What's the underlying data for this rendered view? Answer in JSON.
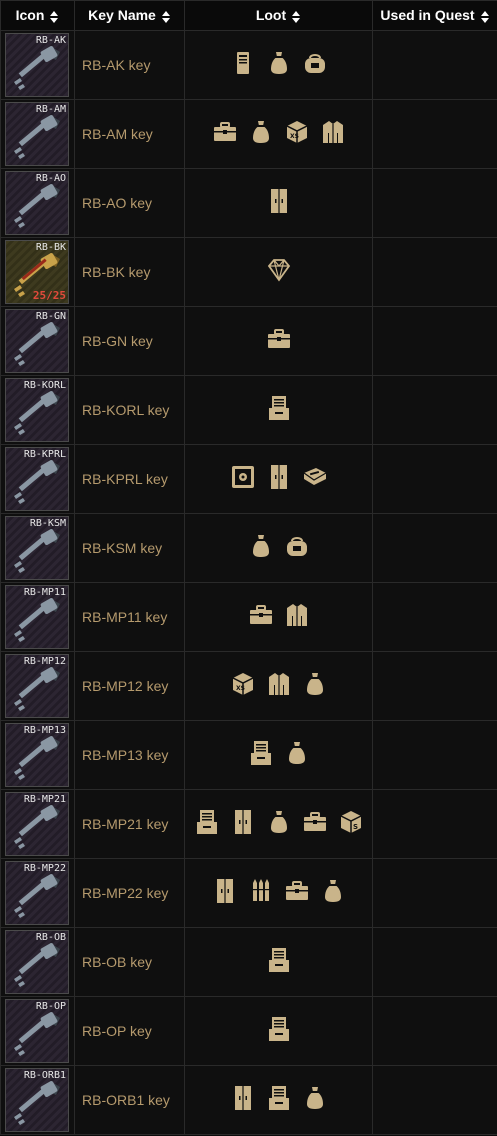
{
  "headers": {
    "icon": "Icon",
    "name": "Key Name",
    "loot": "Loot",
    "quest": "Used in Quest"
  },
  "rows": [
    {
      "code": "RB-AK",
      "name": "RB-AK key",
      "loot": [
        "pc-tower-icon",
        "sack-icon",
        "duffle-bag-icon"
      ],
      "uses": ""
    },
    {
      "code": "RB-AM",
      "name": "RB-AM key",
      "loot": [
        "toolbox-icon",
        "sack-icon",
        "xs-crate-icon",
        "jacket-icon"
      ],
      "uses": ""
    },
    {
      "code": "RB-AO",
      "name": "RB-AO key",
      "loot": [
        "locker-icon"
      ],
      "uses": ""
    },
    {
      "code": "RB-BK",
      "name": "RB-BK key",
      "loot": [
        "diamond-icon"
      ],
      "uses": "25/25"
    },
    {
      "code": "RB-GN",
      "name": "RB-GN key",
      "loot": [
        "toolbox-icon"
      ],
      "uses": ""
    },
    {
      "code": "RB-KORL",
      "name": "RB-KORL key",
      "loot": [
        "file-cabinet-icon"
      ],
      "uses": ""
    },
    {
      "code": "RB-KPRL",
      "name": "RB-KPRL key",
      "loot": [
        "safe-icon",
        "locker-icon",
        "weapon-box-icon"
      ],
      "uses": ""
    },
    {
      "code": "RB-KSM",
      "name": "RB-KSM key",
      "loot": [
        "sack-icon",
        "duffle-bag-icon"
      ],
      "uses": ""
    },
    {
      "code": "RB-MP11",
      "name": "RB-MP11 key",
      "loot": [
        "toolbox-icon",
        "jacket-icon"
      ],
      "uses": ""
    },
    {
      "code": "RB-MP12",
      "name": "RB-MP12 key",
      "loot": [
        "xs-crate-icon",
        "jacket-icon",
        "sack-icon"
      ],
      "uses": ""
    },
    {
      "code": "RB-MP13",
      "name": "RB-MP13 key",
      "loot": [
        "file-cabinet-icon",
        "sack-icon"
      ],
      "uses": ""
    },
    {
      "code": "RB-MP21",
      "name": "RB-MP21 key",
      "loot": [
        "file-cabinet-icon",
        "locker-icon",
        "sack-icon",
        "toolbox-icon",
        "s-crate-icon"
      ],
      "uses": ""
    },
    {
      "code": "RB-MP22",
      "name": "RB-MP22 key",
      "loot": [
        "locker-icon",
        "ammo-icon",
        "toolbox-icon",
        "sack-icon"
      ],
      "uses": ""
    },
    {
      "code": "RB-OB",
      "name": "RB-OB key",
      "loot": [
        "file-cabinet-icon"
      ],
      "uses": ""
    },
    {
      "code": "RB-OP",
      "name": "RB-OP key",
      "loot": [
        "file-cabinet-icon"
      ],
      "uses": ""
    },
    {
      "code": "RB-ORB1",
      "name": "RB-ORB1 key",
      "loot": [
        "locker-icon",
        "file-cabinet-icon",
        "sack-icon"
      ],
      "uses": ""
    }
  ],
  "colors": {
    "loot_icon": "#c9b48a",
    "key_name": "#b59a6d",
    "uses_badge": "#e24a3b",
    "key_metal": "#8a97a3"
  }
}
